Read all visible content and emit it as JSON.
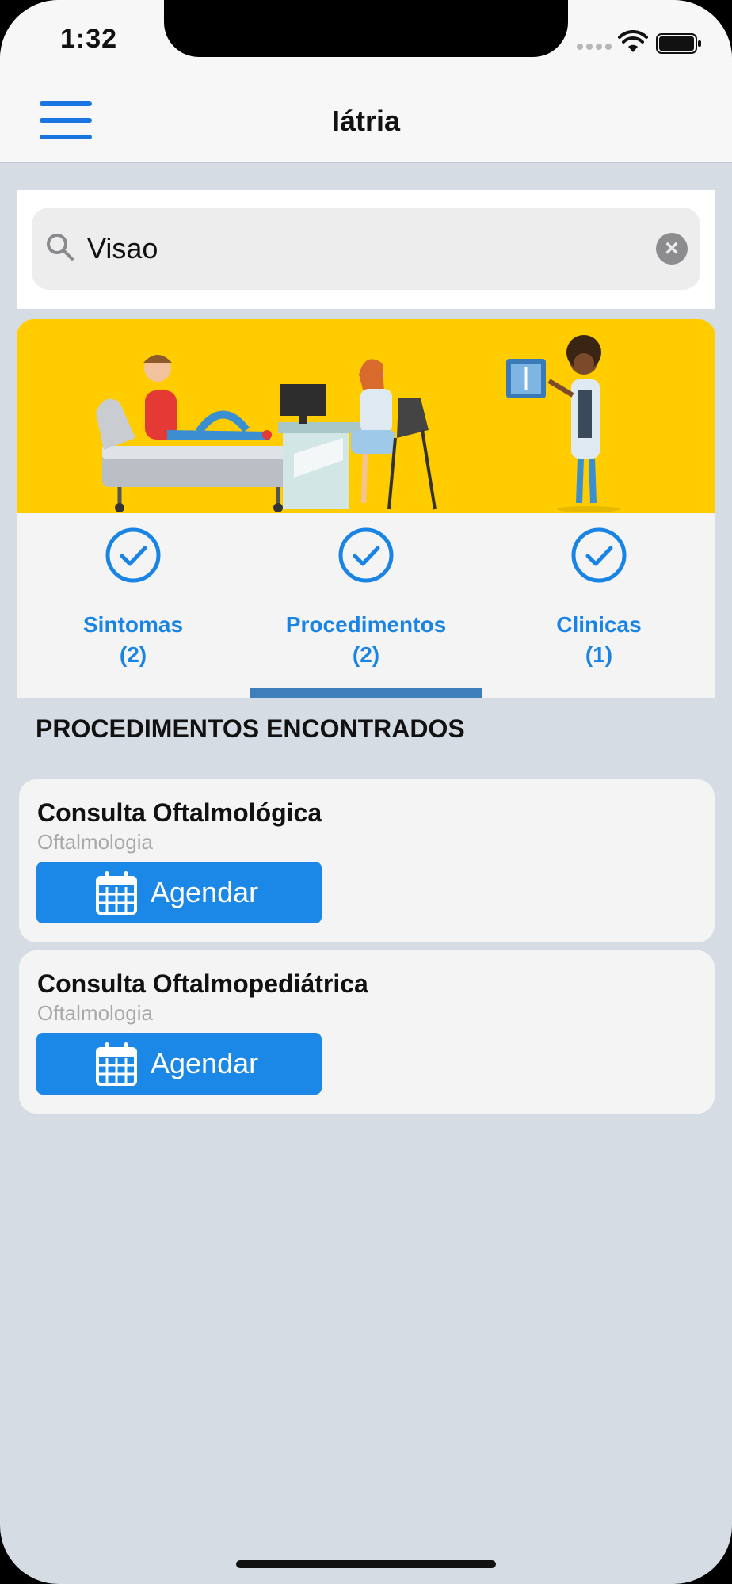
{
  "status_bar": {
    "time": "1:32"
  },
  "nav": {
    "title": "Iátria",
    "menu_icon": "hamburger-menu-icon"
  },
  "search": {
    "value": "Visao",
    "icon": "search-icon",
    "clear_icon": "clear-icon"
  },
  "colors": {
    "accent": "#1b87e6",
    "banner": "#ffcc00",
    "tab_indicator": "#3d7fba",
    "background": "#d6dce4"
  },
  "tabs": [
    {
      "label": "Sintomas",
      "count": "(2)",
      "icon": "check-circle-icon"
    },
    {
      "label": "Procedimentos",
      "count": "(2)",
      "icon": "check-circle-icon",
      "selected": true
    },
    {
      "label": "Clinicas",
      "count": "(1)",
      "icon": "check-circle-icon"
    }
  ],
  "section": {
    "title": "PROCEDIMENTOS ENCONTRADOS"
  },
  "procedures": [
    {
      "name": "Consulta Oftalmológica",
      "specialty": "Oftalmologia",
      "button": "Agendar"
    },
    {
      "name": "Consulta Oftalmopediátrica",
      "specialty": "Oftalmologia",
      "button": "Agendar"
    }
  ]
}
